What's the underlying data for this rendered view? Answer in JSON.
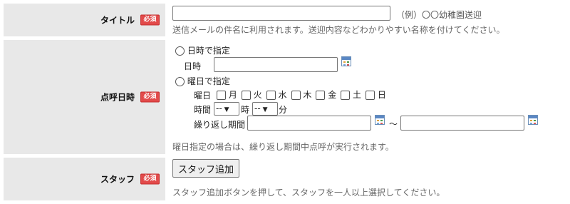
{
  "required_badge": "必須",
  "title_row": {
    "label": "タイトル",
    "input_value": "",
    "example": "（例）〇〇幼稚園送迎",
    "hint": "送信メールの件名に利用されます。送迎内容などわかりやすい名称を付けてください。"
  },
  "rollcall_row": {
    "label": "点呼日時",
    "option_datetime": "日時で指定",
    "datetime_label": "日時",
    "datetime_value": "",
    "option_weekday": "曜日で指定",
    "weekday_label": "曜日",
    "weekdays": [
      "月",
      "火",
      "水",
      "木",
      "金",
      "土",
      "日"
    ],
    "time_label": "時間",
    "hour_select": "--",
    "hour_unit": "時",
    "minute_select": "--",
    "minute_unit": "分",
    "repeat_label": "繰り返し期間",
    "repeat_start": "",
    "repeat_end": "",
    "tilde": "～",
    "hint": "曜日指定の場合は、繰り返し期間中点呼が実行されます。"
  },
  "staff_row": {
    "label": "スタッフ",
    "button": "スタッフ追加",
    "hint": "スタッフ追加ボタンを押して、スタッフを一人以上選択してください。"
  },
  "icons": {
    "calendar": "calendar-icon",
    "dropdown": "chevron-down-icon"
  }
}
